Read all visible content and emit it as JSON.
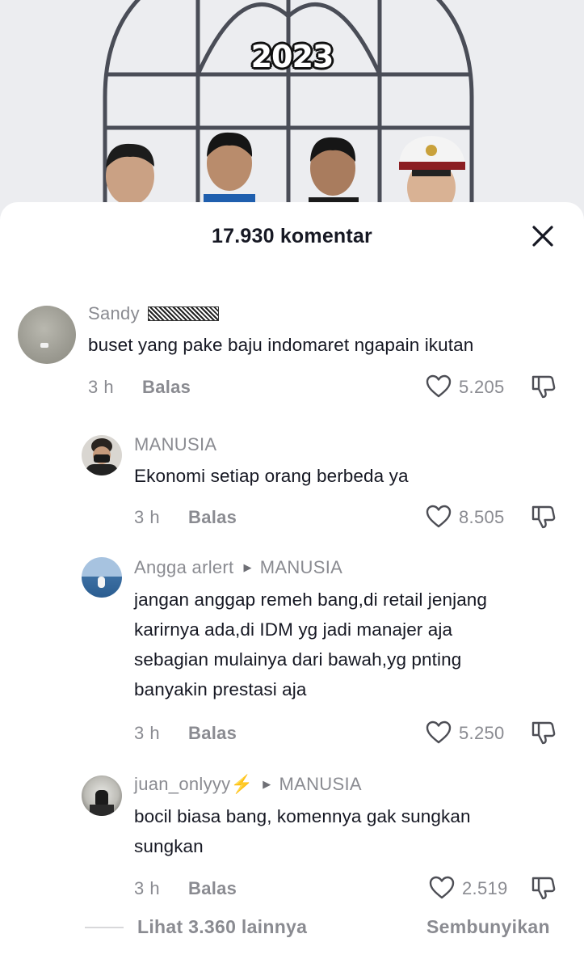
{
  "video": {
    "overlay_text": "2023"
  },
  "sheet": {
    "title": "17.930 komentar",
    "close_icon": "close-icon"
  },
  "comments": [
    {
      "username": "Sandy",
      "text": "buset yang pake baju indomaret ngapain ikutan",
      "time": "3 h",
      "reply_label": "Balas",
      "likes": "5.205"
    },
    {
      "username": "MANUSIA",
      "text": "Ekonomi setiap orang berbeda ya",
      "time": "3 h",
      "reply_label": "Balas",
      "likes": "8.505"
    },
    {
      "username": "Angga arlert",
      "reply_to": "MANUSIA",
      "text": "jangan anggap remeh bang,di retail jenjang\nkarirnya ada,di IDM yg jadi manajer aja\nsebagian mulainya dari bawah,yg pnting\nbanyakin prestasi aja",
      "time": "3 h",
      "reply_label": "Balas",
      "likes": "5.250"
    },
    {
      "username": "juan_onlyyy⚡",
      "reply_to": "MANUSIA",
      "text": "bocil biasa bang, komennya gak sungkan\nsungkan",
      "time": "3 h",
      "reply_label": "Balas",
      "likes": "2.519"
    }
  ],
  "footer": {
    "view_more": "Lihat 3.360 lainnya",
    "hide": "Sembunyikan"
  },
  "icons": {
    "like": "heart-outline-icon",
    "dislike": "thumbs-down-icon",
    "arrow": "reply-arrow-icon"
  },
  "colors": {
    "text": "#161823",
    "secondary": "#8a8b91",
    "background": "#ffffff"
  }
}
